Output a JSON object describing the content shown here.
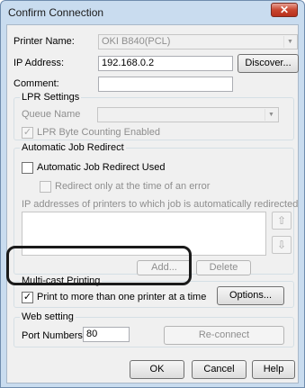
{
  "window": {
    "title": "Confirm Connection",
    "close_glyph": "✕"
  },
  "printer": {
    "label": "Printer Name:",
    "value": "OKI B840(PCL)"
  },
  "ip": {
    "label": "IP Address:",
    "value": "192.168.0.2",
    "discover_label": "Discover..."
  },
  "comment": {
    "label": "Comment:",
    "value": ""
  },
  "lpr": {
    "legend": "LPR Settings",
    "queue_label": "Queue Name",
    "queue_value": "",
    "byte_counting_label": "LPR Byte Counting Enabled",
    "byte_counting_checked": true
  },
  "redirect": {
    "legend": "Automatic Job Redirect",
    "used_label": "Automatic Job Redirect Used",
    "used_checked": false,
    "error_only_label": "Redirect only at the time of an error",
    "error_only_checked": false,
    "list_label": "IP addresses of printers to which job is automatically redirected",
    "up_glyph": "⇧",
    "down_glyph": "⇩",
    "add_label": "Add...",
    "delete_label": "Delete"
  },
  "multicast": {
    "legend": "Multi-cast Printing",
    "print_label": "Print to more than one printer at a time",
    "print_checked": true,
    "options_label": "Options..."
  },
  "web": {
    "legend": "Web setting",
    "port_label": "Port Numbers",
    "port_value": "80",
    "reconnect_label": "Re-connect"
  },
  "footer": {
    "ok_label": "OK",
    "cancel_label": "Cancel",
    "help_label": "Help"
  },
  "icons": {
    "check": "✓",
    "dropdown": "▼"
  }
}
